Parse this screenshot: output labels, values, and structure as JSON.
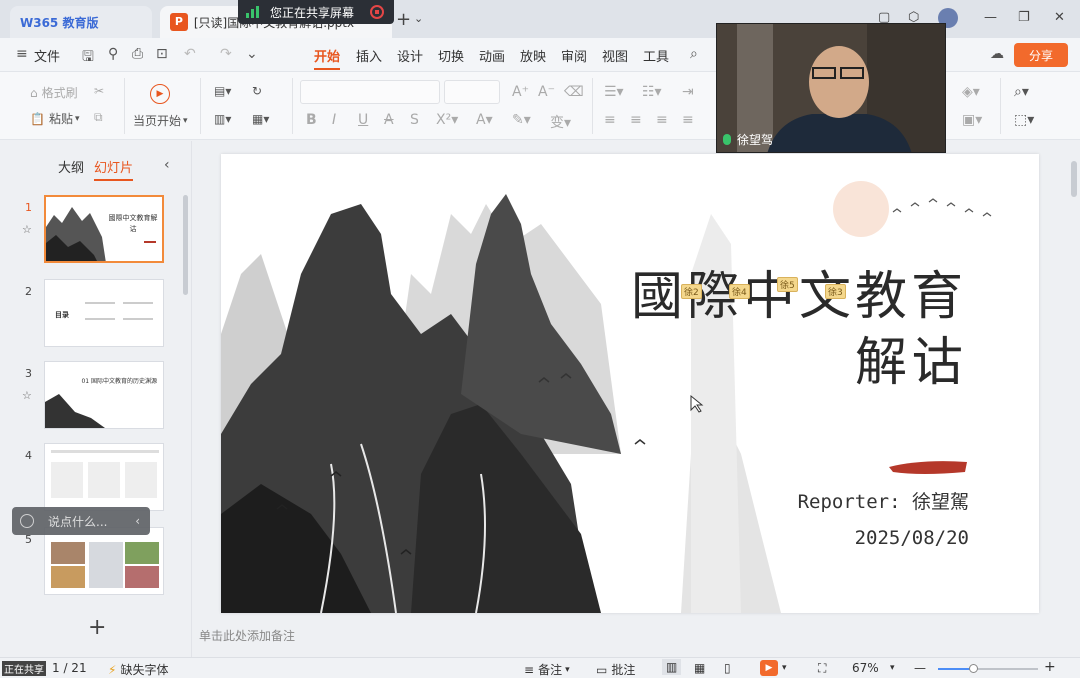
{
  "titlebar": {
    "app_tab": "W365 教育版",
    "doc_tab": "[只读]国际中文教育解诂.pptx",
    "share_banner": "您正在共享屏幕"
  },
  "menubar": {
    "file_label": "文件",
    "tabs": [
      "开始",
      "插入",
      "设计",
      "切换",
      "动画",
      "放映",
      "审阅",
      "视图",
      "工具"
    ],
    "active_tab": "开始",
    "share_label": "分享"
  },
  "ribbon": {
    "format_painter": "格式刷",
    "paste": "粘贴",
    "play_from_current": "当页开始"
  },
  "leftpanel": {
    "tabs": [
      "大纲",
      "幻灯片"
    ],
    "active_tab": "幻灯片",
    "slides": [
      {
        "num": "1",
        "title": "國際中文教育解诂"
      },
      {
        "num": "2",
        "title": "目录"
      },
      {
        "num": "3",
        "title": "01 国际中文教育的历史渊源"
      },
      {
        "num": "4",
        "title": ""
      },
      {
        "num": "5",
        "title": ""
      }
    ],
    "chat_placeholder": "说点什么..."
  },
  "slide": {
    "title_line1": "國際中文教育",
    "title_line2": "解诂",
    "reporter": "Reporter: 徐望駕",
    "date": "2025/08/20",
    "tags": [
      "徐2",
      "徐4",
      "徐5",
      "徐3"
    ],
    "accent_color": "#b5382a"
  },
  "notes_placeholder": "单击此处添加备注",
  "video": {
    "name": "徐望驾"
  },
  "statusbar": {
    "sharing": "正在共享",
    "page": "1 / 21",
    "missing_font": "缺失字体",
    "notes": "备注",
    "comments": "批注",
    "zoom": "67%",
    "zoom_level": 0.35
  }
}
